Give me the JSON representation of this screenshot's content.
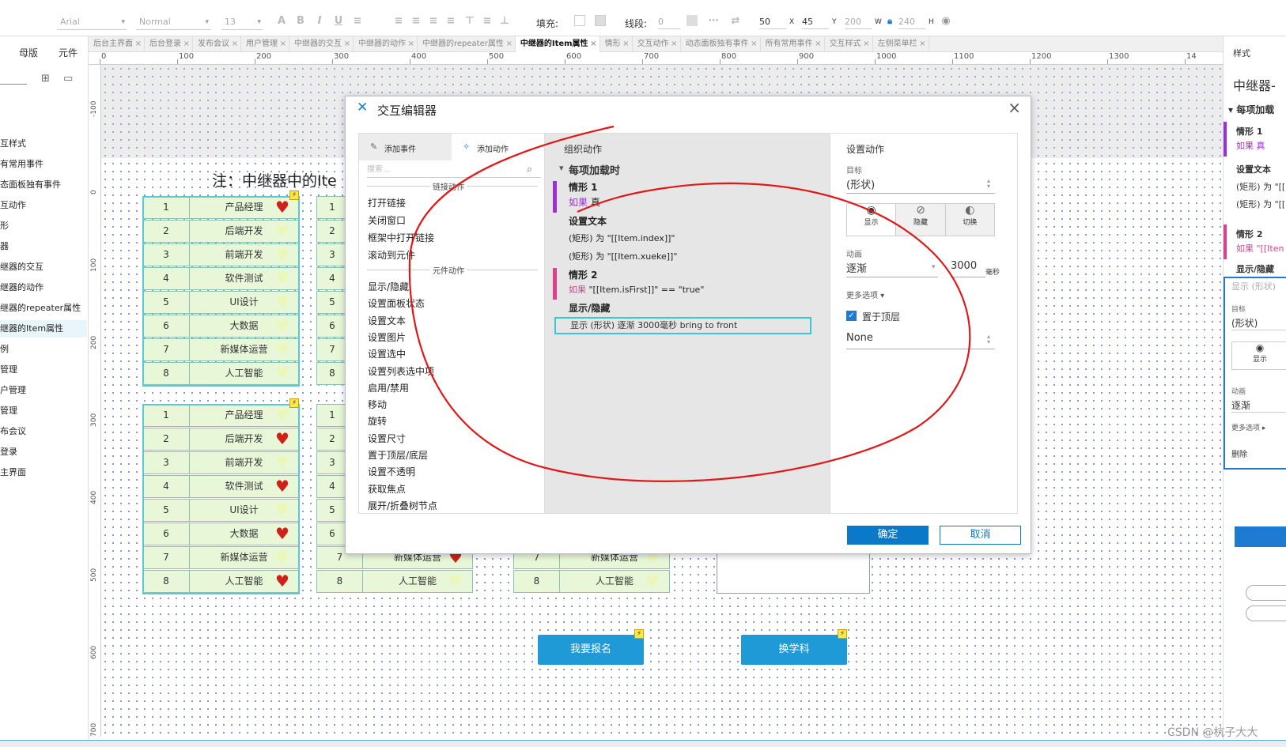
{
  "toolbar": {
    "font": "Arial",
    "style": "Normal",
    "size": "13",
    "fill_label": "填充:",
    "line_label": "线段:",
    "line_value": "0",
    "x_value": "50",
    "x_label": "X",
    "y_value": "45",
    "y_label": "Y",
    "w_value": "200",
    "w_label": "W",
    "h_value": "240",
    "h_label": "H"
  },
  "tabs": [
    "后台主界面",
    "后台登录",
    "发布会议",
    "用户管理",
    "中继器的交互",
    "中继器的动作",
    "中继器的repeater属性",
    "中继器的Item属性",
    "情形",
    "交互动作",
    "动态面板独有事件",
    "所有常用事件",
    "交互样式",
    "左侧菜单栏"
  ],
  "active_tab_index": 7,
  "left_panel": {
    "tab_master": "母版",
    "tab_widget": "元件",
    "items": [
      "互样式",
      "有常用事件",
      "态面板独有事件",
      "互动作",
      "形",
      "器",
      "继器的交互",
      "继器的动作",
      "继器的repeater属性",
      "继器的Item属性",
      "例",
      "管理",
      "户管理",
      "管理",
      "布会议",
      "登录",
      "主界面"
    ],
    "selected_index": 9
  },
  "ruler_h": [
    "0",
    "100",
    "200",
    "300",
    "400",
    "500",
    "600",
    "700",
    "800",
    "900",
    "1000",
    "1100",
    "1200",
    "1300",
    "14"
  ],
  "ruler_v": [
    "-100",
    "0",
    "100",
    "200",
    "300",
    "400",
    "500",
    "600",
    "700"
  ],
  "canvas": {
    "note": "注：中继器中的Ite",
    "numbers": [
      "1",
      "2",
      "3",
      "4",
      "5",
      "6",
      "7",
      "8"
    ],
    "subjects": [
      "产品经理",
      "后端开发",
      "前端开发",
      "软件测试",
      "UI设计",
      "大数据",
      "新媒体运营",
      "人工智能"
    ],
    "signup_button": "我要报名",
    "switch_button": "换学科"
  },
  "right_panel": {
    "style_tab": "样式",
    "title": "中继器-",
    "section": "每项加载",
    "case1": "情形 1",
    "if_true": "如果 真",
    "set_text": "设置文本",
    "rect1": "(矩形) 为 \"[[",
    "rect2": "(矩形) 为 \"[[",
    "case2": "情形 2",
    "if2": "如果 \"[[Iten",
    "show_hide": "显示/隐藏",
    "show_shape": "显示 (形状)",
    "target_label": "目标",
    "target_value": "(形状)",
    "show_label": "显示",
    "anim_label": "动画",
    "anim_value": "逐渐",
    "more": "更多选项 ▸",
    "delete": "删除"
  },
  "dialog": {
    "title": "交互编辑器",
    "left": {
      "tab_add_event": "添加事件",
      "tab_add_action": "添加动作",
      "search_placeholder": "搜索...",
      "link_section": "链接动作",
      "link_actions": [
        "打开链接",
        "关闭窗口",
        "框架中打开链接",
        "滚动到元件"
      ],
      "widget_section": "元件动作",
      "widget_actions": [
        "显示/隐藏",
        "设置面板状态",
        "设置文本",
        "设置图片",
        "设置选中",
        "设置列表选中项",
        "启用/禁用",
        "移动",
        "旋转",
        "设置尺寸",
        "置于顶层/底层",
        "设置不透明",
        "获取焦点",
        "展开/折叠树节点"
      ]
    },
    "middle": {
      "header": "组织动作",
      "event": "每项加载时",
      "case1": "情形 1",
      "case1_cond_kw": "如果",
      "case1_cond": "真",
      "action_settext": "设置文本",
      "settext_1": "(矩形) 为 \"[[Item.index]]\"",
      "settext_2": "(矩形) 为 \"[[Item.xueke]]\"",
      "case2": "情形 2",
      "case2_cond_kw": "如果",
      "case2_cond": "\"[[Item.isFirst]]\" == \"true\"",
      "action_showhide": "显示/隐藏",
      "showhide_detail": "显示 (形状) 逐渐 3000毫秒 bring to front"
    },
    "right": {
      "header": "设置动作",
      "target_label": "目标",
      "target_value": "(形状)",
      "btn_show": "显示",
      "btn_hide": "隐藏",
      "btn_toggle": "切换",
      "anim_label": "动画",
      "anim_value": "逐渐",
      "duration": "3000",
      "duration_unit": "毫秒",
      "more_options": "更多选项 ▾",
      "bring_front": "置于顶层",
      "none_value": "None"
    },
    "ok": "确定",
    "cancel": "取消"
  },
  "colors": {
    "accent": "#0b79c8",
    "case_purple": "#9b30d9",
    "case_pink": "#e0408a",
    "heart_red": "#d0201a",
    "heart_light": "#eaf7b8",
    "annotation_red": "#e01818"
  },
  "watermark": "CSDN @杭子大大"
}
